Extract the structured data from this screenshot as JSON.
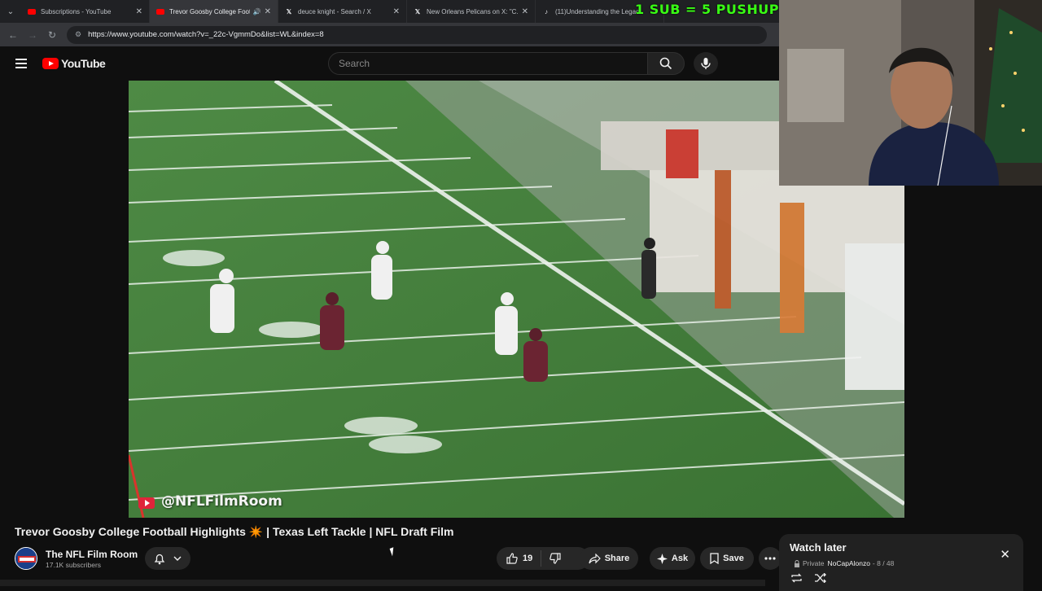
{
  "browser": {
    "tabs": [
      {
        "title": "Subscriptions - YouTube",
        "favicon": "youtube-icon",
        "active": false
      },
      {
        "title": "Trevor Goosby College Foot",
        "favicon": "youtube-icon",
        "active": true,
        "audio": true
      },
      {
        "title": "deuce knight - Search / X",
        "favicon": "x-icon",
        "active": false
      },
      {
        "title": "New Orleans Pelicans on X: \"C...",
        "favicon": "x-icon",
        "active": false
      },
      {
        "title": "(11)Understanding the Legac",
        "favicon": "tiktok-icon",
        "active": false
      }
    ],
    "url": "https://www.youtube.com/watch?v=_22c-VgmmDo&list=WL&index=8"
  },
  "stream_overlay": "1 SUB = 5 PUSHUPS",
  "youtube": {
    "logo_text": "YouTube",
    "search_placeholder": "Search"
  },
  "video": {
    "watermark": "@NFLFilmRoom",
    "title_part1": "Trevor Goosby College Football Highlights",
    "title_emoji": "✴️",
    "title_part2": "| Texas Left Tackle | NFL Draft Film"
  },
  "channel": {
    "name": "The NFL Film Room",
    "subscribers": "17.1K subscribers"
  },
  "actions": {
    "like_count": "19",
    "share": "Share",
    "ask": "Ask",
    "save": "Save"
  },
  "watch_later": {
    "title": "Watch later",
    "privacy": "Private",
    "owner": "NoCapAlonzo",
    "position": "- 8 / 48"
  },
  "colors": {
    "brand_red": "#ff0000",
    "overlay_green": "#39ff14",
    "background": "#0f0f0f"
  }
}
